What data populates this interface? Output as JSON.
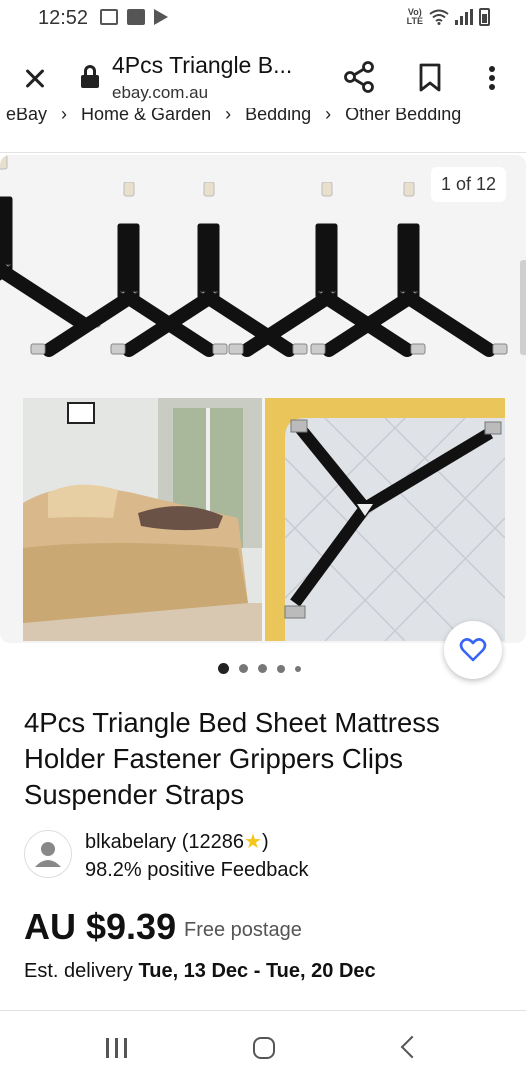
{
  "status_bar": {
    "time": "12:52",
    "lte_top": "Vo)",
    "lte_bottom": "LTE",
    "icons": [
      "mail-icon",
      "gallery-icon",
      "play-store-icon",
      "volte-icon",
      "wifi-icon",
      "signal-icon",
      "battery-charging-icon"
    ]
  },
  "toolbar": {
    "title": "4Pcs Triangle B...",
    "url": "ebay.com.au",
    "icons": [
      "close-icon",
      "lock-icon",
      "share-icon",
      "bookmark-icon",
      "more-vertical-icon"
    ]
  },
  "breadcrumb": {
    "items": [
      "eBay",
      "Home & Garden",
      "Bedding",
      "Other Bedding"
    ],
    "separator": "›"
  },
  "gallery": {
    "counter": "1 of 12",
    "dots_count": 5,
    "active_dot": 0
  },
  "product": {
    "title": "4Pcs Triangle Bed Sheet Mattress Holder Fastener Grippers Clips Suspender Straps"
  },
  "seller": {
    "name": "blkabelary",
    "score_open": "(12286",
    "score_close": ")",
    "star": "★",
    "feedback": "98.2% positive Feedback"
  },
  "pricing": {
    "price": "AU $9.39",
    "postage": "Free postage",
    "delivery_label": "Est. delivery",
    "delivery_dates": "Tue, 13 Dec - Tue, 20 Dec"
  },
  "colors": {
    "accent_heart": "#3665f3",
    "gallery_bg": "#f4f4f4",
    "text": "#111111"
  }
}
